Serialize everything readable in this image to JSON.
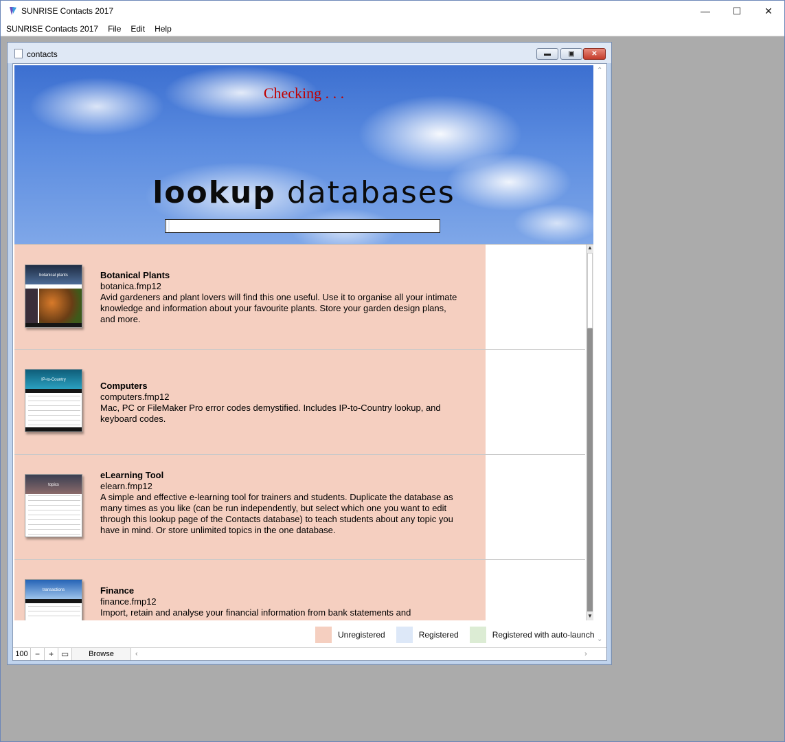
{
  "app": {
    "title": "SUNRISE Contacts 2017",
    "window_controls": {
      "minimize": "—",
      "maximize": "☐",
      "close": "✕"
    }
  },
  "menu": [
    "SUNRISE Contacts 2017",
    "File",
    "Edit",
    "Help"
  ],
  "doc_window": {
    "title": "contacts",
    "controls": {
      "minimize": "▬",
      "maximize": "▣",
      "close": "✕"
    }
  },
  "banner": {
    "status": "Checking . . .",
    "title_bold": "lookup",
    "title_rest": "databases",
    "progress_fraction": 0.02
  },
  "databases": [
    {
      "name": "Botanical Plants",
      "file": "botanica.fmp12",
      "description": "Avid gardeners and plant lovers will find this one useful. Use it to organise all your intimate knowledge and information about your favourite plants. Store your garden design plans, and more.",
      "thumb_caption": "botanical plants",
      "thumb_style": "plants"
    },
    {
      "name": "Computers",
      "file": "computers.fmp12",
      "description": "Mac, PC or FileMaker Pro error codes demystified. Includes IP-to-Country lookup, and keyboard codes.",
      "thumb_caption": "IP-to-Country",
      "thumb_style": "teal"
    },
    {
      "name": "eLearning Tool",
      "file": "elearn.fmp12",
      "description": "A simple and effective e-learning tool for trainers and students. Duplicate the database as many times as you like (can be run independently, but select which one you want to edit through this lookup page of the Contacts database) to teach students about any topic you have in mind. Or store unlimited topics in the one database.",
      "thumb_caption": "topics",
      "thumb_style": "rust"
    },
    {
      "name": "Finance",
      "file": "finance.fmp12",
      "description": "Import, retain and analyse your financial information from bank statements and",
      "thumb_caption": "transactions",
      "thumb_style": "blue"
    }
  ],
  "legend": [
    {
      "label": "Unregistered",
      "color": "#f5cfc0"
    },
    {
      "label": "Registered",
      "color": "#dde8f8"
    },
    {
      "label": "Registered with auto-launch",
      "color": "#dcecd4"
    }
  ],
  "statusbar": {
    "zoom": "100",
    "mode": "Browse"
  }
}
